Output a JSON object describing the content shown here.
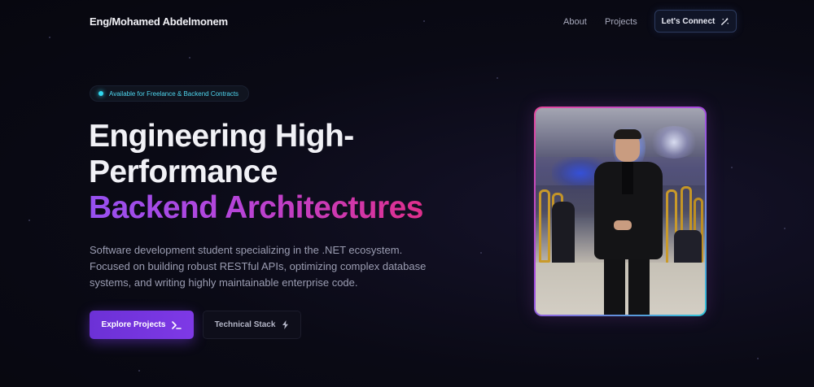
{
  "nav": {
    "brand": "Eng/Mohamed Abdelmonem",
    "links": [
      "About",
      "Projects"
    ],
    "cta_label": "Let's Connect",
    "cta_icon": "magic-wand-icon"
  },
  "hero": {
    "badge": "Available for Freelance & Backend Contracts",
    "title_line1": "Engineering High-",
    "title_line2": "Performance",
    "title_line3": "Backend Architectures",
    "description": "Software development student specializing in the .NET ecosystem. Focused on building robust RESTful APIs, optimizing complex database systems, and writing highly maintainable enterprise code.",
    "primary_button": {
      "label": "Explore Projects",
      "icon": "terminal-icon"
    },
    "secondary_button": {
      "label": "Technical Stack",
      "icon": "lightning-icon"
    }
  },
  "colors": {
    "background": "#0a0a15",
    "accent_purple": "#7e39e6",
    "accent_pink": "#e02f8c",
    "accent_cyan": "#31d8ef"
  }
}
